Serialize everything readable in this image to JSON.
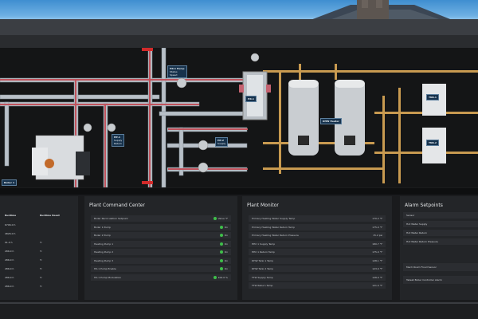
{
  "schematic": {
    "tags": [
      {
        "title": "HX-1 Pump",
        "lines": [
          "Status",
          "Speed",
          "Set"
        ]
      },
      {
        "title": "Boiler 1",
        "lines": []
      },
      {
        "title": "HP-1",
        "lines": [
          "Supply",
          "Return"
        ]
      },
      {
        "title": "HP-2",
        "lines": [
          "Supply",
          "Return"
        ]
      },
      {
        "title": "DHW Heater",
        "lines": []
      },
      {
        "title": "TNK-1",
        "lines": []
      },
      {
        "title": "TNK-2",
        "lines": []
      },
      {
        "title": "HX-1",
        "lines": []
      }
    ],
    "labels": [
      "HX-1",
      "TNK-1",
      "TNK-2"
    ]
  },
  "panels": {
    "left": {
      "headers": [
        "Runtime",
        "Runtime Reset"
      ],
      "rows": [
        {
          "runtime": "6706.0 h",
          "reset": ""
        },
        {
          "runtime": "4826.0 h",
          "reset": ""
        },
        {
          "runtime": "91.0 h",
          "reset": "↻"
        },
        {
          "runtime": "286.0 h",
          "reset": "↻"
        },
        {
          "runtime": "286.0 h",
          "reset": "↻"
        },
        {
          "runtime": "286.0 h",
          "reset": "↻"
        },
        {
          "runtime": "286.0 h",
          "reset": "↻"
        },
        {
          "runtime": "286.0 h",
          "reset": "↻"
        }
      ]
    },
    "command": {
      "title": "Plant Command Center",
      "rows": [
        {
          "label": "Boiler Recirculation Setpoint",
          "value": "Value °F"
        },
        {
          "label": "Boiler 1 Pump",
          "value": "On"
        },
        {
          "label": "Boiler 2 Pump",
          "value": "On"
        },
        {
          "label": "Heating Pump 1",
          "value": "On"
        },
        {
          "label": "Heating Pump 2",
          "value": "On"
        },
        {
          "label": "Heating Pump 3",
          "value": "On"
        },
        {
          "label": "HX-1 Pump Enable",
          "value": "On"
        },
        {
          "label": "HX-1 Pump Modulation",
          "value": "100.0 %"
        }
      ]
    },
    "monitor": {
      "title": "Plant Monitor",
      "rows": [
        {
          "label": "Primary Heating Water Supply Temp",
          "value": "170.2 °F"
        },
        {
          "label": "Primary Heating Water Return Temp",
          "value": "175.0 °F"
        },
        {
          "label": "Primary Heating Water Return Pressure",
          "value": "15.2 psi"
        },
        {
          "label": "HEX 1 Supply Temp",
          "value": "180.7 °F"
        },
        {
          "label": "HEX 1 Return Temp",
          "value": "175.0 °F"
        },
        {
          "label": "DHW Tank 1 Temp",
          "value": "128.1 °F"
        },
        {
          "label": "DHW Tank 2 Temp",
          "value": "123.0 °F"
        },
        {
          "label": "TTW Supply Temp",
          "value": "128.0 °F"
        },
        {
          "label": "TTW Return Temp",
          "value": "121.0 °F"
        }
      ]
    },
    "alarm": {
      "title": "Alarm Setpoints",
      "rows": [
        "Sensor",
        "Hot Water Supply",
        "Hot Water Return",
        "Hot Water Return Pressure"
      ],
      "sensors": [
        "Mech Room Flood Sensor",
        "Takeat Boiler Controller Alarm"
      ]
    }
  }
}
